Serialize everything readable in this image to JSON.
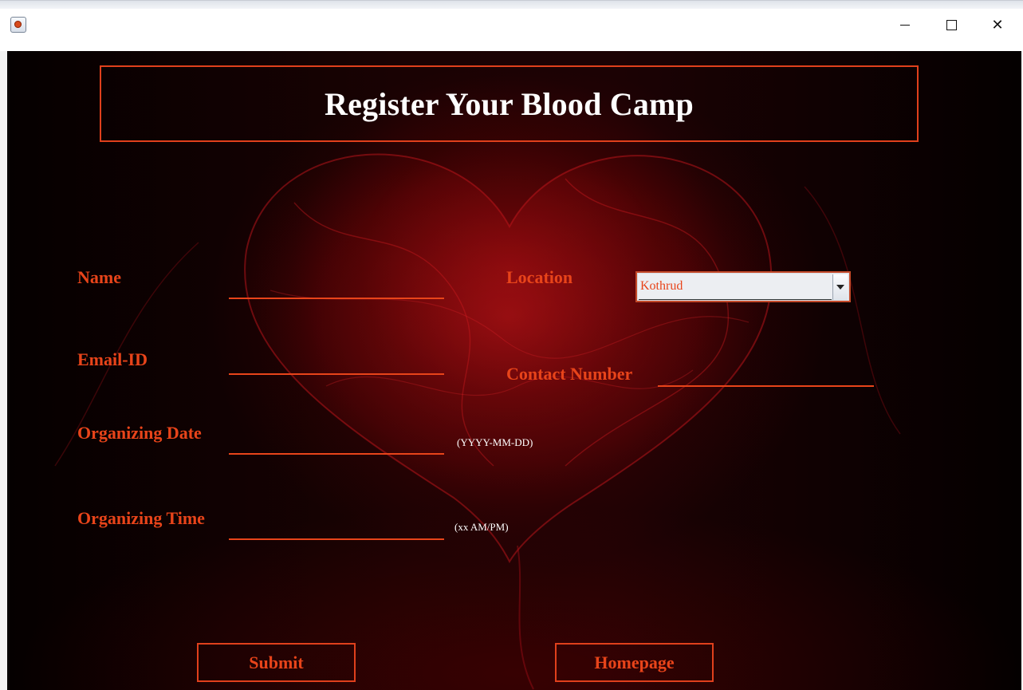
{
  "window": {
    "app_icon": "java-cup-icon",
    "controls": {
      "minimize_icon": "minimize-icon",
      "maximize_icon": "maximize-icon",
      "close_icon": "close-icon",
      "close_glyph": "✕"
    }
  },
  "form": {
    "title": "Register Your Blood Camp",
    "labels": {
      "name": "Name",
      "email": "Email-ID",
      "date": "Organizing Date",
      "time": "Organizing Time",
      "location": "Location",
      "contact": "Contact Number"
    },
    "values": {
      "name": "",
      "email": "",
      "date": "",
      "time": "",
      "contact": ""
    },
    "hints": {
      "date": "(YYYY-MM-DD)",
      "time": "(xx AM/PM)"
    },
    "location_selected": "Kothrud",
    "buttons": {
      "submit": "Submit",
      "homepage": "Homepage"
    }
  },
  "colors": {
    "accent": "#e8441a",
    "title": "#ffffff",
    "background": "#1a0203"
  }
}
